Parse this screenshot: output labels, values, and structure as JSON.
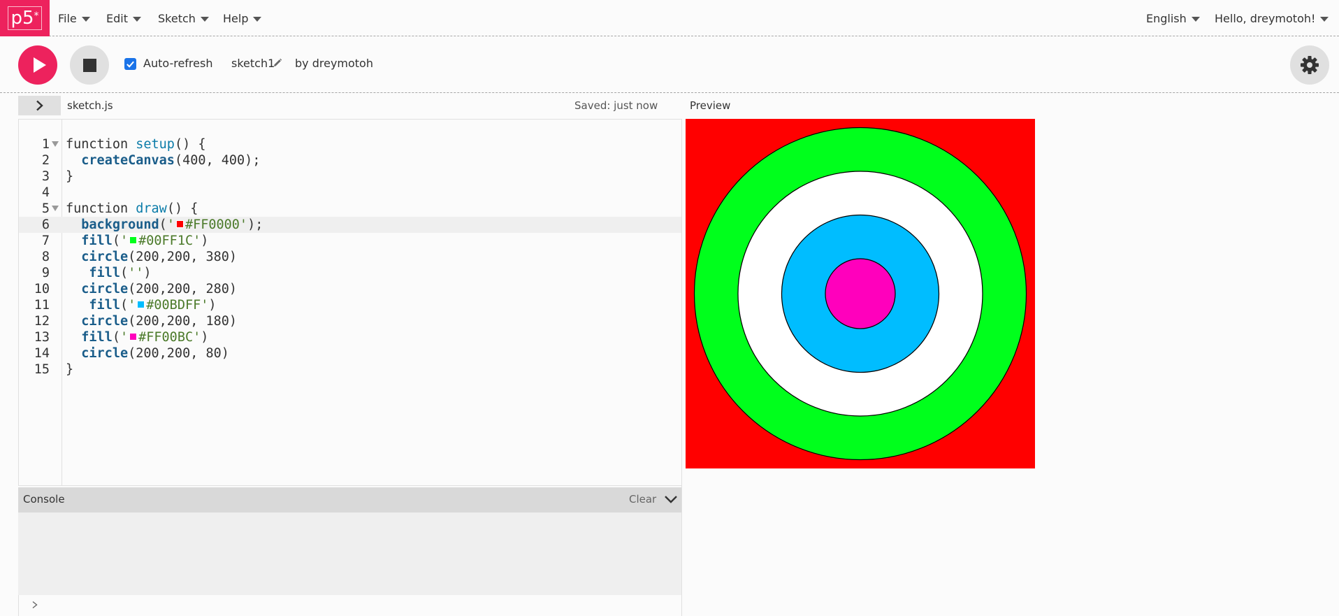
{
  "nav": {
    "logo_text": "p5",
    "logo_sup": "*",
    "menus": [
      {
        "label": "File"
      },
      {
        "label": "Edit"
      },
      {
        "label": "Sketch"
      },
      {
        "label": "Help"
      }
    ],
    "language": "English",
    "user_greeting": "Hello, dreymotoh!"
  },
  "toolbar": {
    "auto_refresh_label": "Auto-refresh",
    "auto_refresh_checked": true,
    "sketch_name": "sketch1",
    "byline": "by dreymotoh"
  },
  "editor": {
    "filename": "sketch.js",
    "saved_status": "Saved: just now",
    "active_line": 6,
    "lines": [
      {
        "num": "1",
        "text": "function setup() {"
      },
      {
        "num": "2",
        "text": "  createCanvas(400, 400);"
      },
      {
        "num": "3",
        "text": "}"
      },
      {
        "num": "4",
        "text": ""
      },
      {
        "num": "5",
        "text": "function draw() {"
      },
      {
        "num": "6",
        "text": "  background('#FF0000');"
      },
      {
        "num": "7",
        "text": "  fill('#00FF1C')"
      },
      {
        "num": "8",
        "text": "  circle(200,200, 380)"
      },
      {
        "num": "9",
        "text": "   fill('')"
      },
      {
        "num": "10",
        "text": "  circle(200,200, 280)"
      },
      {
        "num": "11",
        "text": "   fill('#00BDFF')"
      },
      {
        "num": "12",
        "text": "  circle(200,200, 180)"
      },
      {
        "num": "13",
        "text": "  fill('#FF00BC')"
      },
      {
        "num": "14",
        "text": "  circle(200,200, 80)"
      },
      {
        "num": "15",
        "text": "}"
      }
    ]
  },
  "console": {
    "title": "Console",
    "clear_label": "Clear"
  },
  "preview": {
    "label": "Preview",
    "background": "#FF0000",
    "circles": [
      {
        "diameter": 380,
        "fill": "#00FF1C"
      },
      {
        "diameter": 280,
        "fill": "#FFFFFF"
      },
      {
        "diameter": 180,
        "fill": "#00BDFF"
      },
      {
        "diameter": 80,
        "fill": "#FF00BC"
      }
    ]
  },
  "colors": {
    "brand": "#ED225D"
  }
}
